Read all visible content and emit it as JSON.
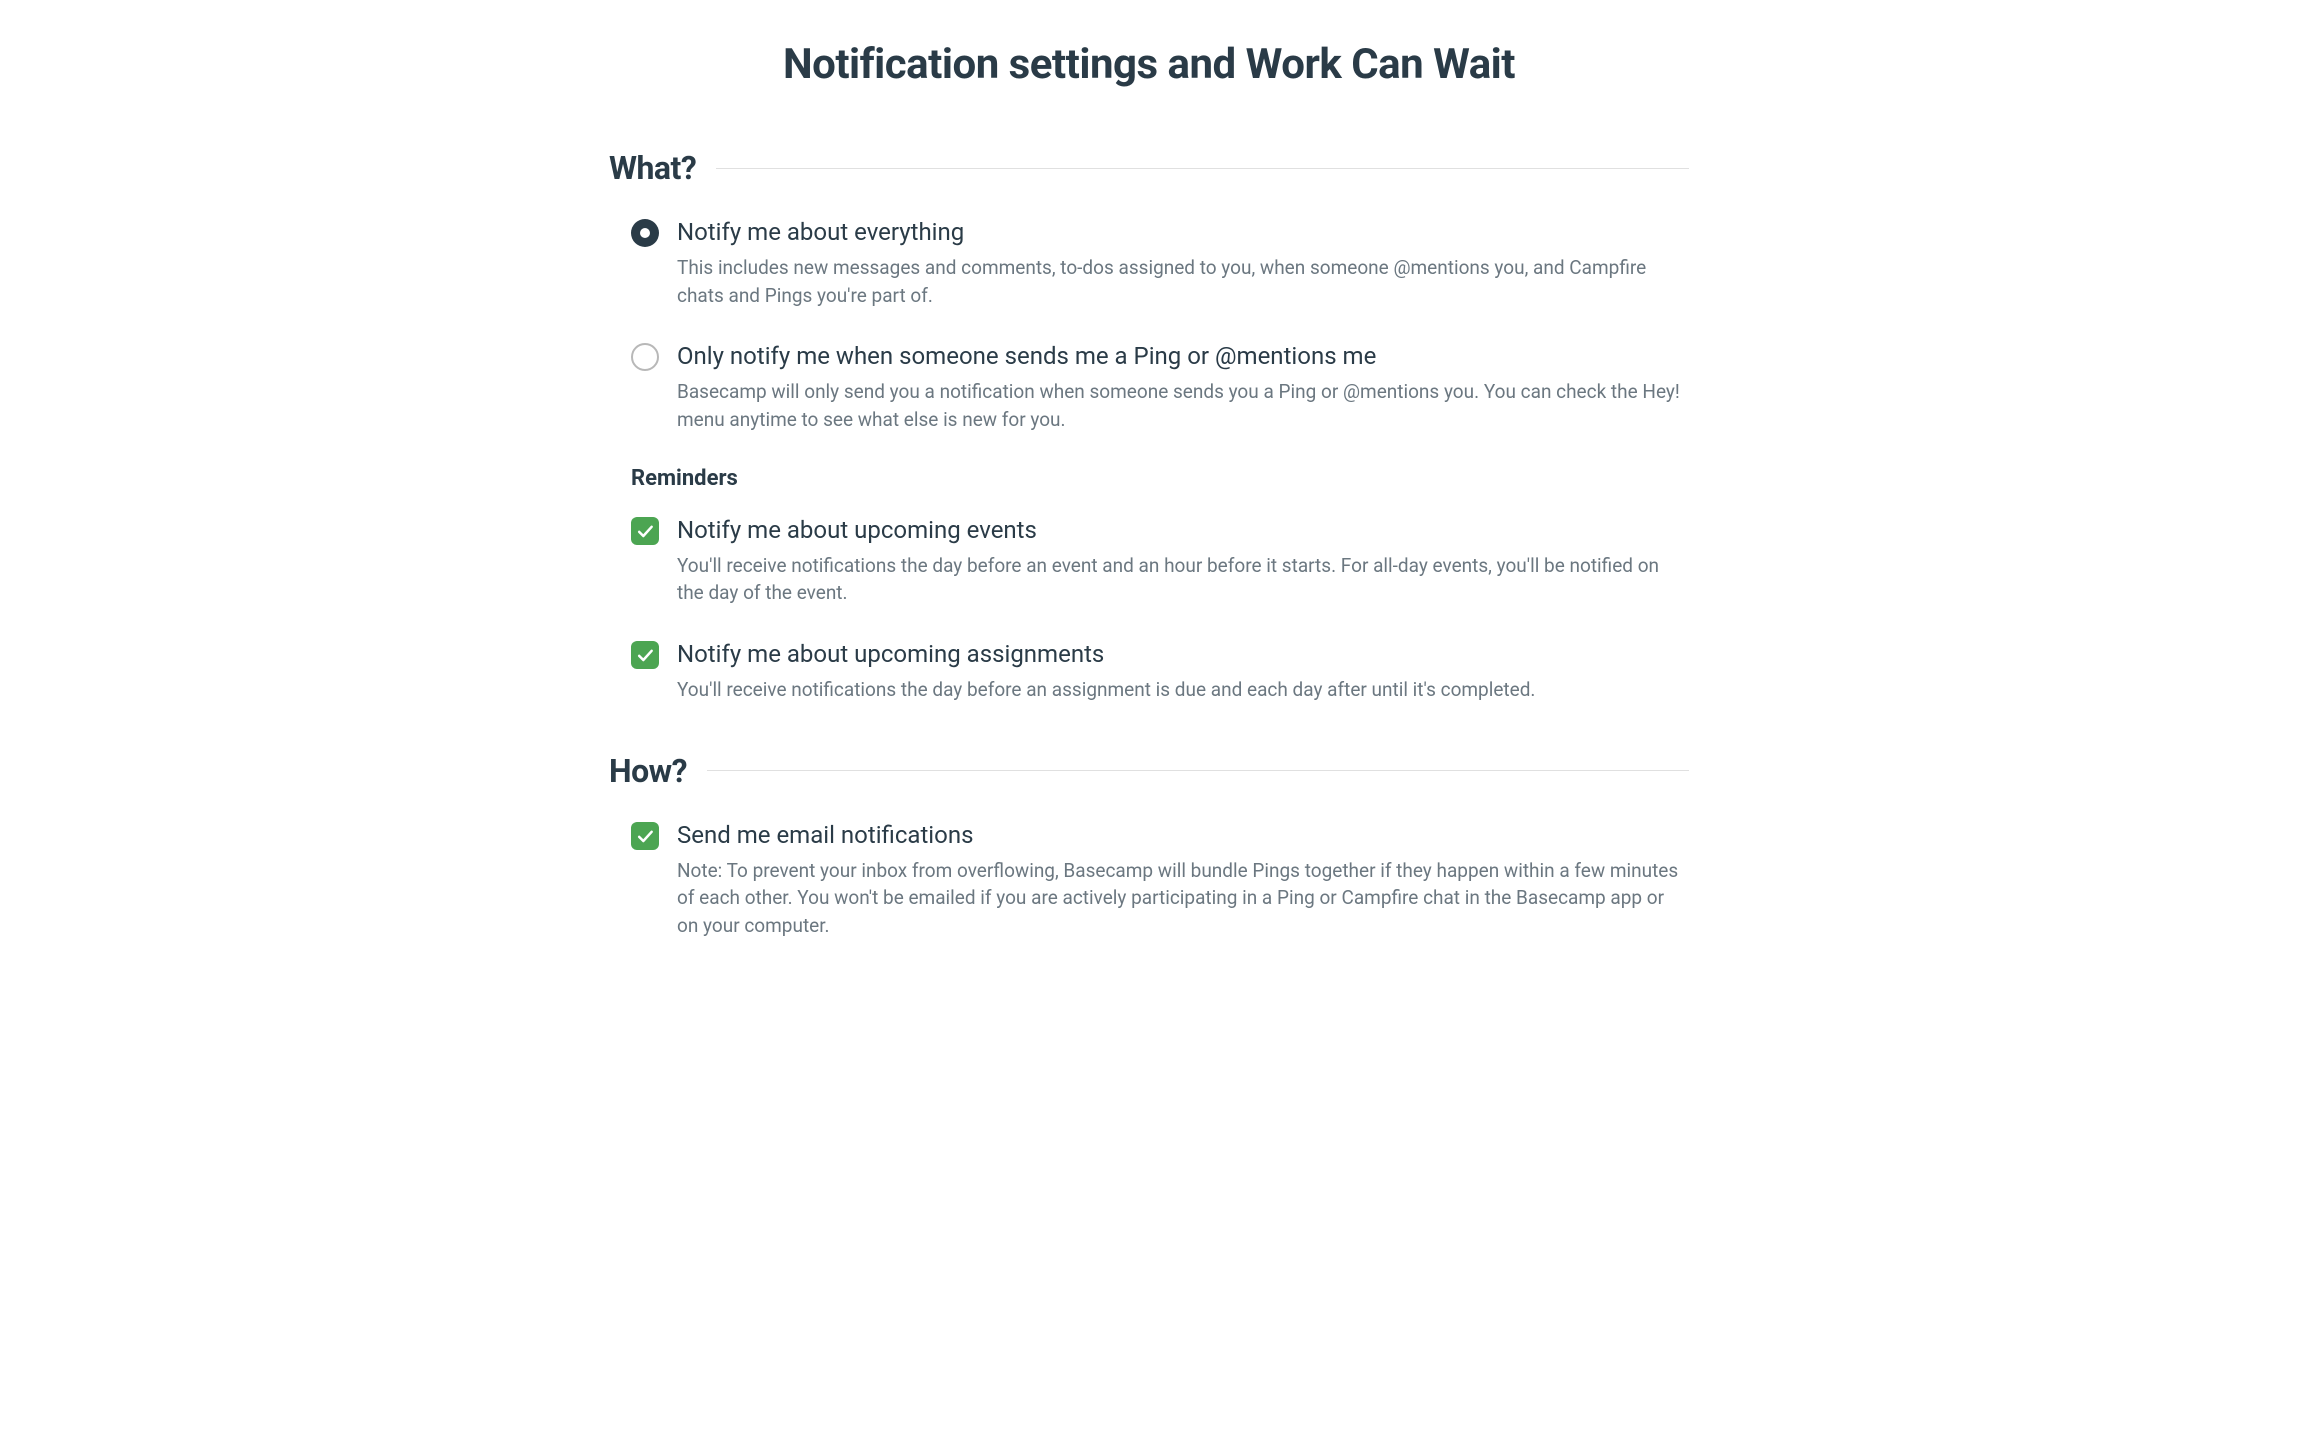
{
  "page_title": "Notification settings and Work Can Wait",
  "sections": {
    "what": {
      "title": "What?",
      "options": [
        {
          "title": "Notify me about everything",
          "description": "This includes new messages and comments, to-dos assigned to you, when someone @mentions you, and Campfire chats and Pings you're part of."
        },
        {
          "title": "Only notify me when someone sends me a Ping or @mentions me",
          "description": "Basecamp will only send you a notification when someone sends you a Ping or @mentions you. You can check the Hey! menu anytime to see what else is new for you."
        }
      ],
      "reminders": {
        "title": "Reminders",
        "options": [
          {
            "title": "Notify me about upcoming events",
            "description": "You'll receive notifications the day before an event and an hour before it starts. For all-day events, you'll be notified on the day of the event."
          },
          {
            "title": "Notify me about upcoming assignments",
            "description": "You'll receive notifications the day before an assignment is due and each day after until it's completed."
          }
        ]
      }
    },
    "how": {
      "title": "How?",
      "options": [
        {
          "title": "Send me email notifications",
          "description": "Note: To prevent your inbox from overflowing, Basecamp will bundle Pings together if they happen within a few minutes of each other. You won't be emailed if you are actively participating in a Ping or Campfire chat in the Basecamp app or on your computer."
        }
      ]
    }
  }
}
